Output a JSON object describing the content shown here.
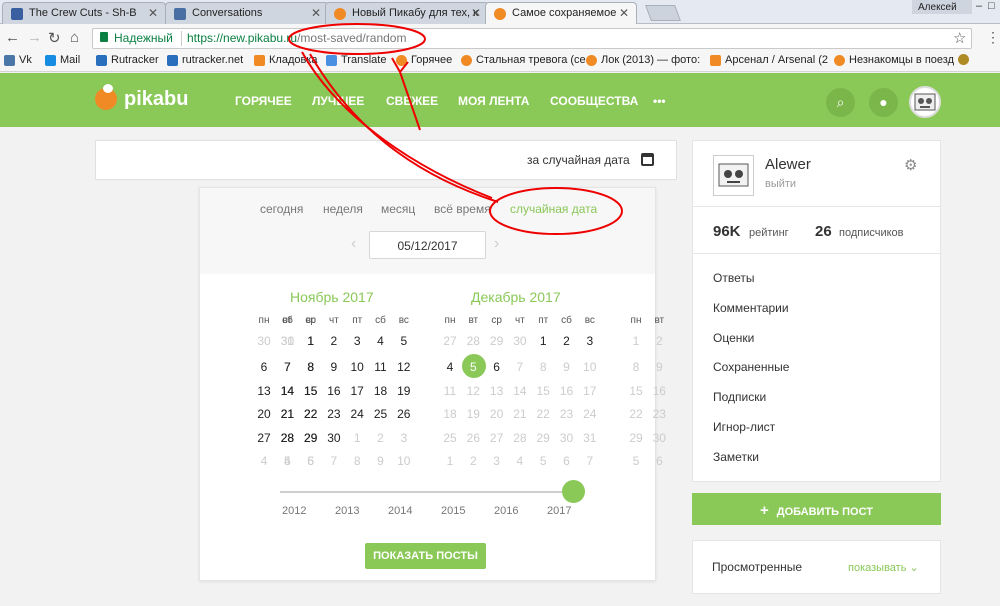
{
  "browser": {
    "tabs": [
      {
        "title": "The Crew Cuts - Sh-B",
        "favicon_color": "#3a5fa0"
      },
      {
        "title": "Conversations",
        "favicon_color": "#4a6fa5"
      },
      {
        "title": "Новый Пикабу для тех, к",
        "favicon_color": "#f08a24"
      },
      {
        "title": "Самое сохраняемое",
        "favicon_color": "#f08a24"
      }
    ],
    "user_chip": "Алексей",
    "secure_label": "Надежный",
    "url_host": "https://new.pikabu.ru",
    "url_path": "/most-saved/random",
    "bookmarks": [
      {
        "label": "Vk",
        "color": "#4a76a8"
      },
      {
        "label": "Mail",
        "color": "#168de2"
      },
      {
        "label": "Rutracker",
        "color": "#2a6fbd"
      },
      {
        "label": "rutracker.net",
        "color": "#2a6fbd"
      },
      {
        "label": "Кладовка",
        "color": "#f08a24"
      },
      {
        "label": "Translate",
        "color": "#4a90e2"
      },
      {
        "label": "Горячее",
        "color": "#f08a24"
      },
      {
        "label": "Стальная тревога (се",
        "color": "#f08a24"
      },
      {
        "label": "Лок (2013) — фото:",
        "color": "#f08a24"
      },
      {
        "label": "Арсенал / Arsenal (2",
        "color": "#f08a24"
      },
      {
        "label": "Незнакомцы в поезд",
        "color": "#f08a24"
      }
    ]
  },
  "site": {
    "logo": "pikabu",
    "nav": [
      "ГОРЯЧЕЕ",
      "ЛУЧШЕЕ",
      "СВЕЖЕЕ",
      "МОЯ ЛЕНТА",
      "СООБЩЕСТВА",
      "•••"
    ],
    "accent": "#8ac858"
  },
  "datebar": {
    "label": "за случайная дата"
  },
  "calendar": {
    "period_tabs": [
      "сегодня",
      "неделя",
      "месяц",
      "всё время",
      "случайная дата"
    ],
    "active_tab": "случайная дата",
    "date_value": "05/12/2017",
    "weekdays": [
      "пн",
      "вт",
      "ср",
      "чт",
      "пт",
      "сб",
      "вс"
    ],
    "months": [
      {
        "title": "Ноябрь 2017"
      },
      {
        "title": "Декабрь 2017"
      }
    ],
    "selected_day": "5",
    "years": [
      "2012",
      "2013",
      "2014",
      "2015",
      "2016",
      "2017"
    ],
    "selected_year": "2017",
    "show_button": "ПОКАЗАТЬ ПОСТЫ"
  },
  "profile": {
    "name": "Alewer",
    "logout": "выйти",
    "rating_value": "96K",
    "rating_label": "рейтинг",
    "subs_value": "26",
    "subs_label": "подписчиков",
    "menu": [
      "Ответы",
      "Комментарии",
      "Оценки",
      "Сохраненные",
      "Подписки",
      "Игнор-лист",
      "Заметки"
    ]
  },
  "add_post": "ДОБАВИТЬ ПОСТ",
  "viewed": {
    "label": "Просмотренные",
    "link": "показывать"
  }
}
